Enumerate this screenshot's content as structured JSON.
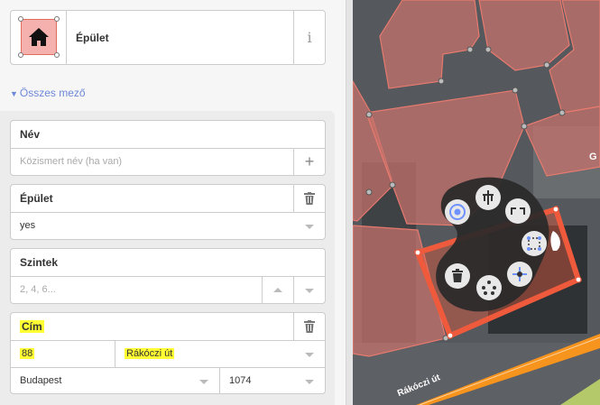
{
  "preset": {
    "name": "Épület",
    "icon": "house-icon",
    "info_glyph": "i"
  },
  "all_fields": {
    "label": "Összes mező",
    "expanded": true
  },
  "fields": {
    "name": {
      "label": "Név",
      "placeholder": "Közismert név (ha van)",
      "add_glyph": "+"
    },
    "building": {
      "label": "Épület",
      "value": "yes"
    },
    "levels": {
      "label": "Szintek",
      "placeholder": "2, 4, 6..."
    },
    "address": {
      "label": "Cím",
      "housenumber": "88",
      "street": "Rákóczi út",
      "city": "Budapest",
      "postcode": "1074"
    }
  },
  "map": {
    "street_label": "Rákóczi út",
    "corner_label": "G",
    "edit_menu": [
      "move-icon",
      "straighten-icon",
      "orthogonalize-icon",
      "square-select-icon",
      "circularize-icon",
      "delete-icon",
      "extract-icon"
    ]
  },
  "colors": {
    "accent_blue": "#6d88d8",
    "building_fill": "#f4b1ad",
    "building_stroke": "#e06e5f",
    "selected_way": "#ef5a3c",
    "road_orange": "#f7941d",
    "highlight": "#ffff33"
  }
}
